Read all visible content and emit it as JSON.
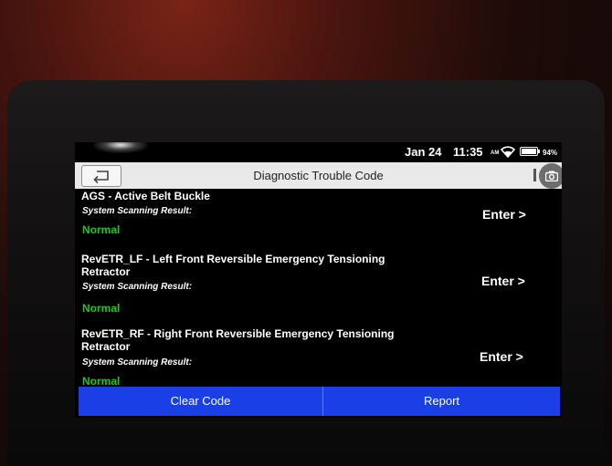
{
  "status_bar": {
    "date": "Jan 24",
    "time": "11:35",
    "am_pm": "AM",
    "battery": "94%"
  },
  "header": {
    "title": "Diagnostic Trouble Code"
  },
  "items": [
    {
      "title": "AGS - Active Belt Buckle",
      "subtitle": "System Scanning Result:",
      "status": "Normal",
      "action": "Enter >"
    },
    {
      "title": "RevETR_LF - Left Front Reversible Emergency Tensioning Retractor",
      "subtitle": "System Scanning Result:",
      "status": "Normal",
      "action": "Enter >"
    },
    {
      "title": "RevETR_RF - Right Front Reversible Emergency Tensioning Retractor",
      "subtitle": "System Scanning Result:",
      "status": "Normal",
      "action": "Enter >"
    }
  ],
  "footer": {
    "clear_code_label": "Clear Code",
    "report_label": "Report"
  },
  "colors": {
    "header_bg": "#e9e9ea",
    "footer_bg": "#1a3fe6",
    "status_ok": "#1ec81e",
    "screen_bg": "#000000"
  },
  "icons": {
    "back": "back-arrow-icon",
    "wifi": "wifi-icon",
    "battery": "battery-icon",
    "camera": "camera-icon"
  }
}
